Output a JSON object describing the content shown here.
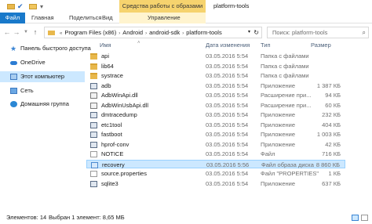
{
  "window": {
    "context_tab_header": "Средства работы с образами диска",
    "title": "platform-tools"
  },
  "ribbon": {
    "tabs": [
      "Файл",
      "Главная",
      "Поделиться",
      "Вид",
      "Управление"
    ]
  },
  "address": {
    "crumbs": [
      "Program Files (x86)",
      "Android",
      "android-sdk",
      "platform-tools"
    ],
    "search_placeholder": "Поиск: platform-tools"
  },
  "nav": {
    "items": [
      {
        "label": "Панель быстрого доступа",
        "icon": "star-icon"
      },
      {
        "label": "OneDrive",
        "icon": "cloud-icon"
      },
      {
        "label": "Этот компьютер",
        "icon": "computer-icon",
        "selected": true
      },
      {
        "label": "Сеть",
        "icon": "network-icon"
      },
      {
        "label": "Домашняя группа",
        "icon": "homegroup-icon"
      }
    ]
  },
  "columns": {
    "name": "Имя",
    "date": "Дата изменения",
    "type": "Тип",
    "size": "Размер"
  },
  "files": [
    {
      "name": "api",
      "date": "03.05.2016 5:54",
      "type": "Папка с файлами",
      "size": "",
      "kind": "folder"
    },
    {
      "name": "lib64",
      "date": "03.05.2016 5:54",
      "type": "Папка с файлами",
      "size": "",
      "kind": "folder"
    },
    {
      "name": "systrace",
      "date": "03.05.2016 5:54",
      "type": "Папка с файлами",
      "size": "",
      "kind": "folder"
    },
    {
      "name": "adb",
      "date": "03.05.2016 5:54",
      "type": "Приложение",
      "size": "1 387 КБ",
      "kind": "app"
    },
    {
      "name": "AdbWinApi.dll",
      "date": "03.05.2016 5:54",
      "type": "Расширение при...",
      "size": "94 КБ",
      "kind": "dll"
    },
    {
      "name": "AdbWinUsbApi.dll",
      "date": "03.05.2016 5:54",
      "type": "Расширение при...",
      "size": "60 КБ",
      "kind": "dll"
    },
    {
      "name": "dmtracedump",
      "date": "03.05.2016 5:54",
      "type": "Приложение",
      "size": "232 КБ",
      "kind": "app"
    },
    {
      "name": "etc1tool",
      "date": "03.05.2016 5:54",
      "type": "Приложение",
      "size": "404 КБ",
      "kind": "app"
    },
    {
      "name": "fastboot",
      "date": "03.05.2016 5:54",
      "type": "Приложение",
      "size": "1 003 КБ",
      "kind": "app"
    },
    {
      "name": "hprof-conv",
      "date": "03.05.2016 5:54",
      "type": "Приложение",
      "size": "42 КБ",
      "kind": "app"
    },
    {
      "name": "NOTICE",
      "date": "03.05.2016 5:54",
      "type": "Файл",
      "size": "716 КБ",
      "kind": "doc"
    },
    {
      "name": "recovery",
      "date": "03.05.2016 5:56",
      "type": "Файл образа диска",
      "size": "8 860 КБ",
      "kind": "img",
      "selected": true
    },
    {
      "name": "source.properties",
      "date": "03.05.2016 5:54",
      "type": "Файл \"PROPERTIES\"",
      "size": "1 КБ",
      "kind": "doc"
    },
    {
      "name": "sqlite3",
      "date": "03.05.2016 5:54",
      "type": "Приложение",
      "size": "637 КБ",
      "kind": "app"
    }
  ],
  "status": {
    "count": "Элементов: 14",
    "selection": "Выбран 1 элемент: 8,65 МБ"
  }
}
